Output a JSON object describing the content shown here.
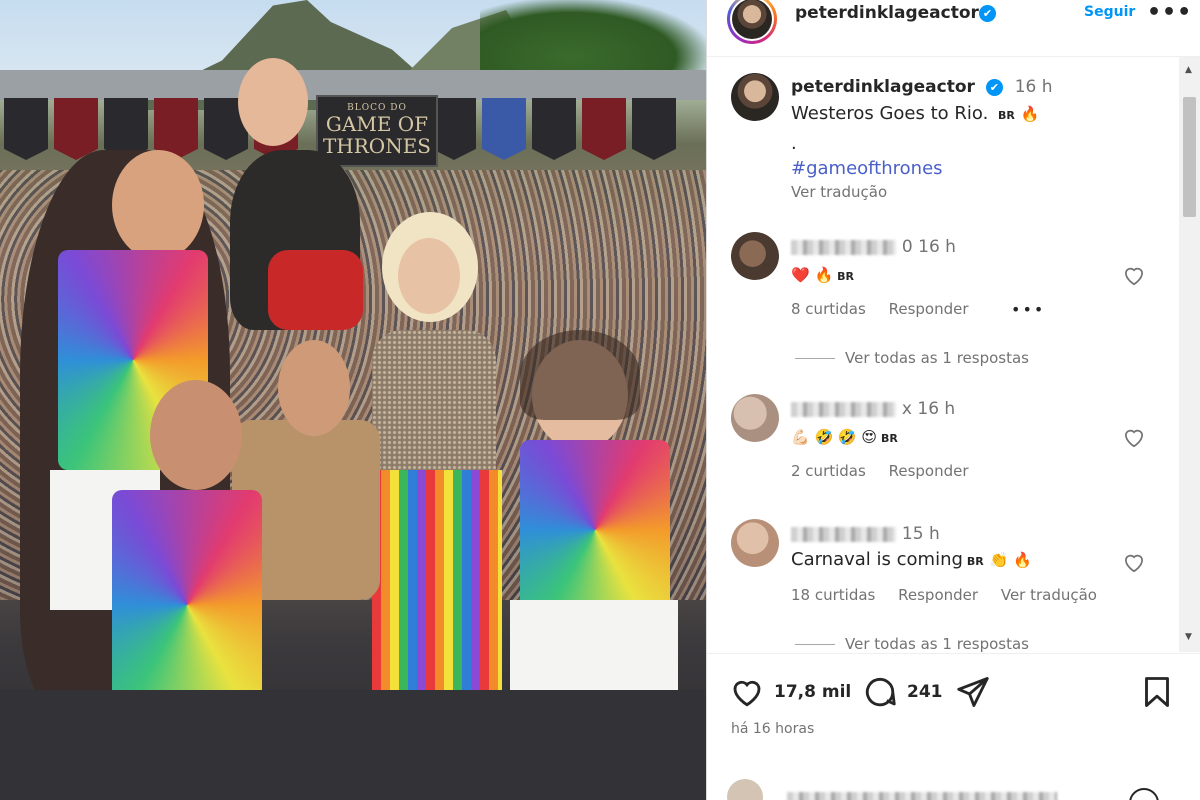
{
  "post": {
    "username": "peterdinklageactor",
    "follow_label": "Seguir",
    "more_label": "•••",
    "verified_mark": "✔",
    "sign_line1": "BLOCO DO",
    "sign_line2a": "GAME OF",
    "sign_line2b": "THRONES"
  },
  "caption": {
    "username": "peterdinklageactor",
    "time": "16 h",
    "line1": "Westeros Goes to Rio.",
    "br": "BR",
    "fire": "🔥",
    "dot": ".",
    "hashtag": "#gameofthrones",
    "translate": "Ver tradução"
  },
  "comments": [
    {
      "time": "0 16 h",
      "text_emojis": "❤️ 🔥",
      "br": "BR",
      "likes": "8 curtidas",
      "reply": "Responder",
      "more": "•••",
      "view_replies": "Ver todas as 1 respostas"
    },
    {
      "time": "x 16 h",
      "text_emojis": "💪🏻 🤣 🤣 😍",
      "br": "BR",
      "likes": "2 curtidas",
      "reply": "Responder"
    },
    {
      "time": "15 h",
      "text": "Carnaval is coming",
      "br": "BR",
      "trail_emojis": "👏 🔥",
      "likes": "18 curtidas",
      "reply": "Responder",
      "translate": "Ver tradução",
      "view_replies": "Ver todas as 1 respostas"
    }
  ],
  "actions": {
    "likes": "17,8 mil",
    "comments": "241",
    "posted": "há 16 horas"
  },
  "colors": {
    "link_blue": "#0095f6",
    "hashtag": "#4a60c8",
    "muted": "#737373",
    "text": "#262626"
  },
  "icons": [
    "verified-icon",
    "more-icon",
    "heart-icon",
    "comment-icon",
    "share-icon",
    "bookmark-icon",
    "scroll-up-icon",
    "scroll-down-icon"
  ]
}
